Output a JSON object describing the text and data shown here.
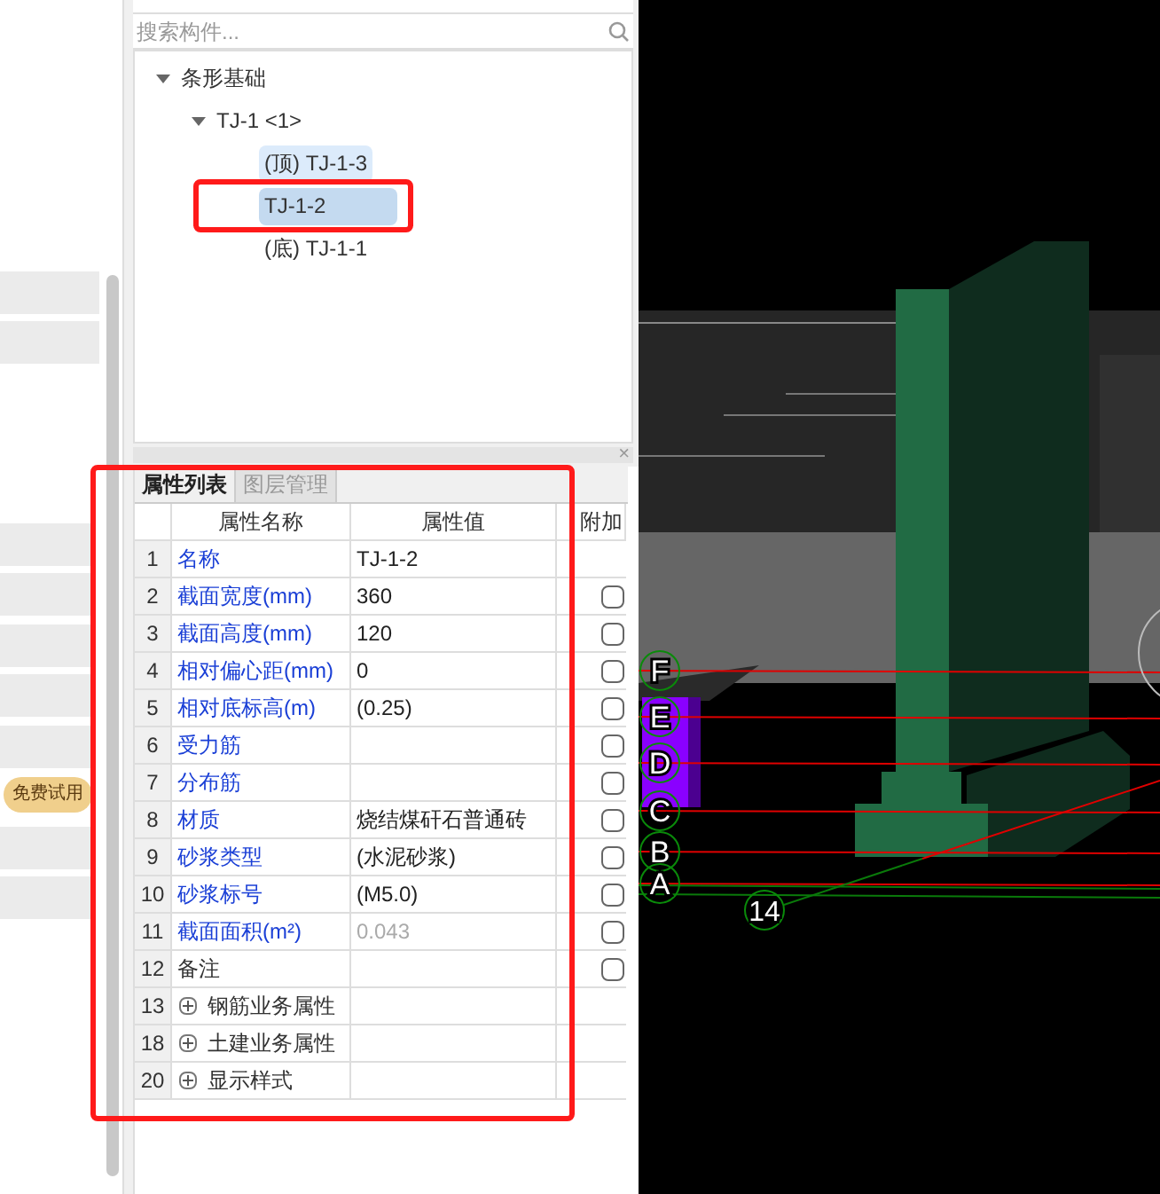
{
  "left_panel": {
    "badge": "免费试用"
  },
  "search": {
    "placeholder": "搜索构件..."
  },
  "tree": [
    {
      "label": "条形基础",
      "expanded": true,
      "selected": false,
      "hovered": false,
      "children": [
        {
          "label": "TJ-1 <1>",
          "expanded": true,
          "selected": false,
          "hovered": false,
          "children": [
            {
              "label": "(顶) TJ-1-3",
              "selected": false,
              "hovered": true
            },
            {
              "label": "TJ-1-2",
              "selected": true,
              "hovered": false
            },
            {
              "label": "(底) TJ-1-1",
              "selected": false,
              "hovered": false
            }
          ]
        }
      ]
    }
  ],
  "properties": {
    "close": "×",
    "tabs": [
      {
        "label": "属性列表",
        "selected": true
      },
      {
        "label": "图层管理",
        "selected": false
      }
    ],
    "columns": [
      "属性名称",
      "属性值",
      "附加"
    ],
    "rows": [
      {
        "kind": "property",
        "number": "1",
        "name": "名称",
        "value": "TJ-1-2",
        "linked": true,
        "disabled": false
      },
      {
        "kind": "property",
        "number": "2",
        "name": "截面宽度(mm)",
        "value": "360",
        "linked": true,
        "disabled": false,
        "checked": false
      },
      {
        "kind": "property",
        "number": "3",
        "name": "截面高度(mm)",
        "value": "120",
        "linked": true,
        "disabled": false,
        "checked": false
      },
      {
        "kind": "property",
        "number": "4",
        "name": "相对偏心距(mm)",
        "value": "0",
        "linked": true,
        "disabled": false,
        "checked": false
      },
      {
        "kind": "property",
        "number": "5",
        "name": "相对底标高(m)",
        "value": "(0.25)",
        "linked": true,
        "disabled": false,
        "checked": false
      },
      {
        "kind": "property",
        "number": "6",
        "name": "受力筋",
        "linked": true,
        "checked": false
      },
      {
        "kind": "property",
        "number": "7",
        "name": "分布筋",
        "linked": true,
        "checked": false
      },
      {
        "kind": "property",
        "number": "8",
        "name": "材质",
        "value": "烧结煤矸石普通砖",
        "linked": true,
        "disabled": false,
        "checked": false
      },
      {
        "kind": "property",
        "number": "9",
        "name": "砂浆类型",
        "value": "(水泥砂浆)",
        "linked": true,
        "disabled": false,
        "checked": false
      },
      {
        "kind": "property",
        "number": "10",
        "name": "砂浆标号",
        "value": "(M5.0)",
        "linked": true,
        "disabled": false,
        "checked": false
      },
      {
        "kind": "property",
        "number": "11",
        "name": "截面面积(m²)",
        "value": "0.043",
        "linked": true,
        "disabled": true,
        "checked": false
      },
      {
        "kind": "property",
        "number": "12",
        "name": "备注",
        "linked": false,
        "checked": false
      },
      {
        "kind": "group",
        "number": "13",
        "name": "钢筋业务属性",
        "expanded": false
      },
      {
        "kind": "group",
        "number": "18",
        "name": "土建业务属性",
        "expanded": false
      },
      {
        "kind": "group",
        "number": "20",
        "name": "显示样式",
        "expanded": false
      }
    ]
  },
  "viewport": {
    "axis_labels": [
      "F",
      "E",
      "D",
      "C",
      "B",
      "A"
    ],
    "column_label": "14"
  }
}
